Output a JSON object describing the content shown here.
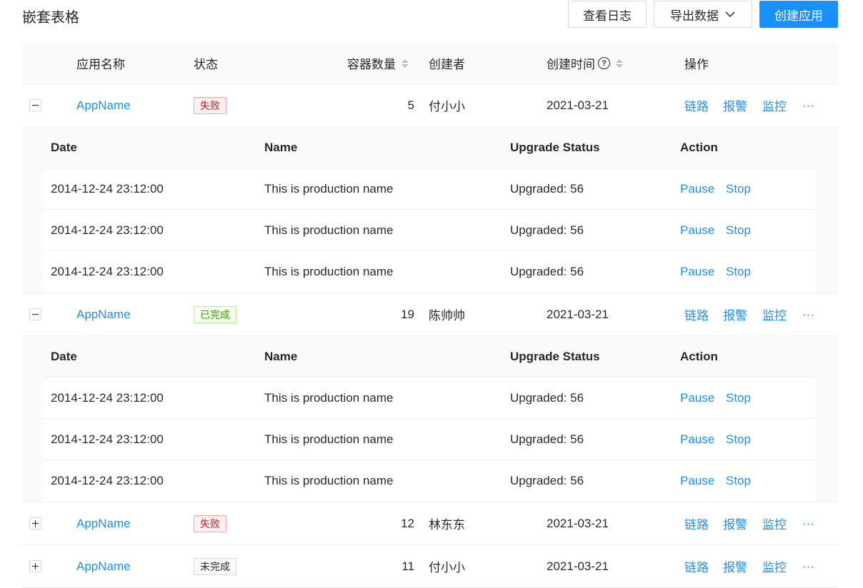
{
  "page_title": "嵌套表格",
  "toolbar": {
    "log_label": "查看日志",
    "export_label": "导出数据",
    "create_label": "创建应用"
  },
  "columns": {
    "name": "应用名称",
    "status": "状态",
    "containers": "容器数量",
    "creator": "创建者",
    "created": "创建时间",
    "actions": "操作"
  },
  "row_actions": {
    "trace": "链路",
    "alert": "报警",
    "monitor": "监控",
    "more": "···"
  },
  "nested_columns": {
    "date": "Date",
    "name": "Name",
    "upgrade": "Upgrade Status",
    "action": "Action"
  },
  "nested_actions": {
    "pause": "Pause",
    "stop": "Stop"
  },
  "rows": [
    {
      "name": "AppName",
      "status": "失败",
      "containers": "5",
      "creator": "付小小",
      "created": "2021-03-21"
    },
    {
      "name": "AppName",
      "status": "已完成",
      "containers": "19",
      "creator": "陈帅帅",
      "created": "2021-03-21"
    },
    {
      "name": "AppName",
      "status": "失败",
      "containers": "12",
      "creator": "林东东",
      "created": "2021-03-21"
    },
    {
      "name": "AppName",
      "status": "未完成",
      "containers": "11",
      "creator": "付小小",
      "created": "2021-03-21"
    }
  ],
  "nested_rows": [
    [
      {
        "date": "2014-12-24 23:12:00",
        "name": "This is production name",
        "upgrade": "Upgraded: 56"
      },
      {
        "date": "2014-12-24 23:12:00",
        "name": "This is production name",
        "upgrade": "Upgraded: 56"
      },
      {
        "date": "2014-12-24 23:12:00",
        "name": "This is production name",
        "upgrade": "Upgraded: 56"
      }
    ],
    [
      {
        "date": "2014-12-24 23:12:00",
        "name": "This is production name",
        "upgrade": "Upgraded: 56"
      },
      {
        "date": "2014-12-24 23:12:00",
        "name": "This is production name",
        "upgrade": "Upgraded: 56"
      },
      {
        "date": "2014-12-24 23:12:00",
        "name": "This is production name",
        "upgrade": "Upgraded: 56"
      }
    ]
  ],
  "colors": {
    "primary": "#1890ff",
    "error": "#cf1322",
    "success": "#389e0d"
  }
}
